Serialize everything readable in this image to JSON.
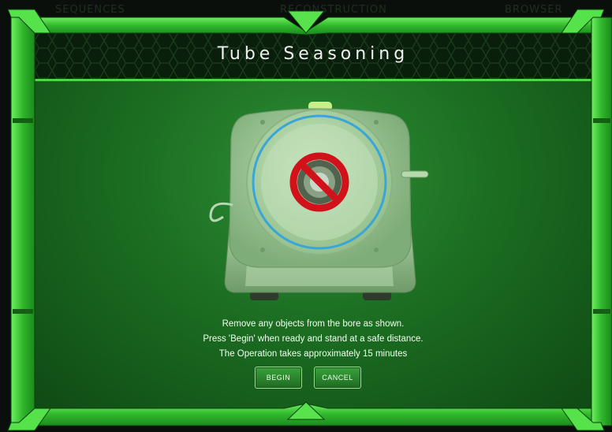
{
  "nav": {
    "tabs": [
      "SEQUENCES",
      "RECONSTRUCTION",
      "BROWSER"
    ]
  },
  "dialog": {
    "title": "Tube Seasoning",
    "messages": [
      "Remove any objects from the bore as shown.",
      "Press 'Begin' when ready and stand at a safe distance.",
      "The Operation takes approximately 15 minutes"
    ],
    "buttons": {
      "begin": "BEGIN",
      "cancel": "CANCEL"
    }
  },
  "colors": {
    "frame_green": "#43d13a",
    "screen_green": "#1c6e22",
    "header_dark": "#0a1f0b",
    "no_sign_red": "#d2121a",
    "bore_ring_blue": "#3aa6d8"
  },
  "icons": [
    "scanner-illustration",
    "no-entry-icon"
  ]
}
